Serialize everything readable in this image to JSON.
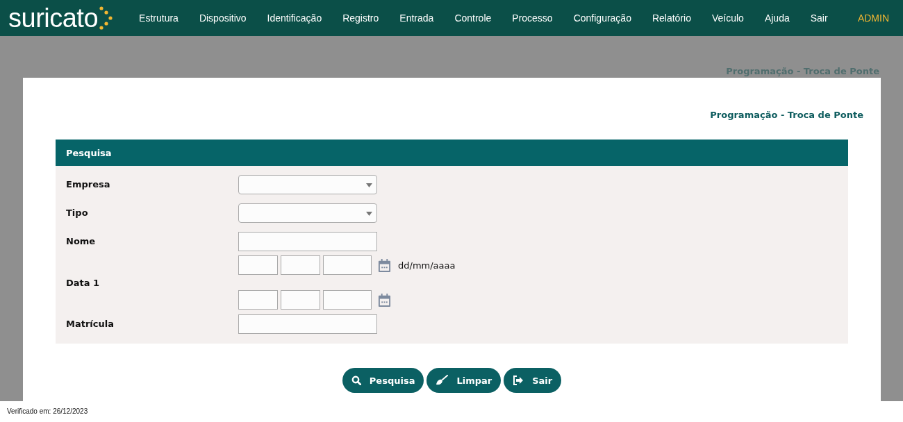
{
  "nav": {
    "logo": "suricato",
    "items": [
      "Estrutura",
      "Dispositivo",
      "Identificação",
      "Registro",
      "Entrada",
      "Controle",
      "Processo",
      "Configuração",
      "Relatório",
      "Veículo",
      "Ajuda",
      "Sair"
    ],
    "user": "ADMIN"
  },
  "background_title": "Programação - Troca de Ponte",
  "modal": {
    "title": "Programação - Troca de Ponte",
    "section": "Pesquisa",
    "fields": [
      {
        "label": "Empresa",
        "kind": "select"
      },
      {
        "label": "Tipo",
        "kind": "select"
      },
      {
        "label": "Nome",
        "kind": "text"
      },
      {
        "label": "Data 1",
        "kind": "date_range",
        "format_hint": "dd/mm/aaaa"
      },
      {
        "label": "Matrícula",
        "kind": "text"
      }
    ],
    "buttons": [
      {
        "label": "Pesquisa",
        "kind": "search"
      },
      {
        "label": "Limpar",
        "kind": "clear"
      },
      {
        "label": "Sair",
        "kind": "exit"
      }
    ]
  },
  "footer": "Verificado em: 26/12/2023"
}
